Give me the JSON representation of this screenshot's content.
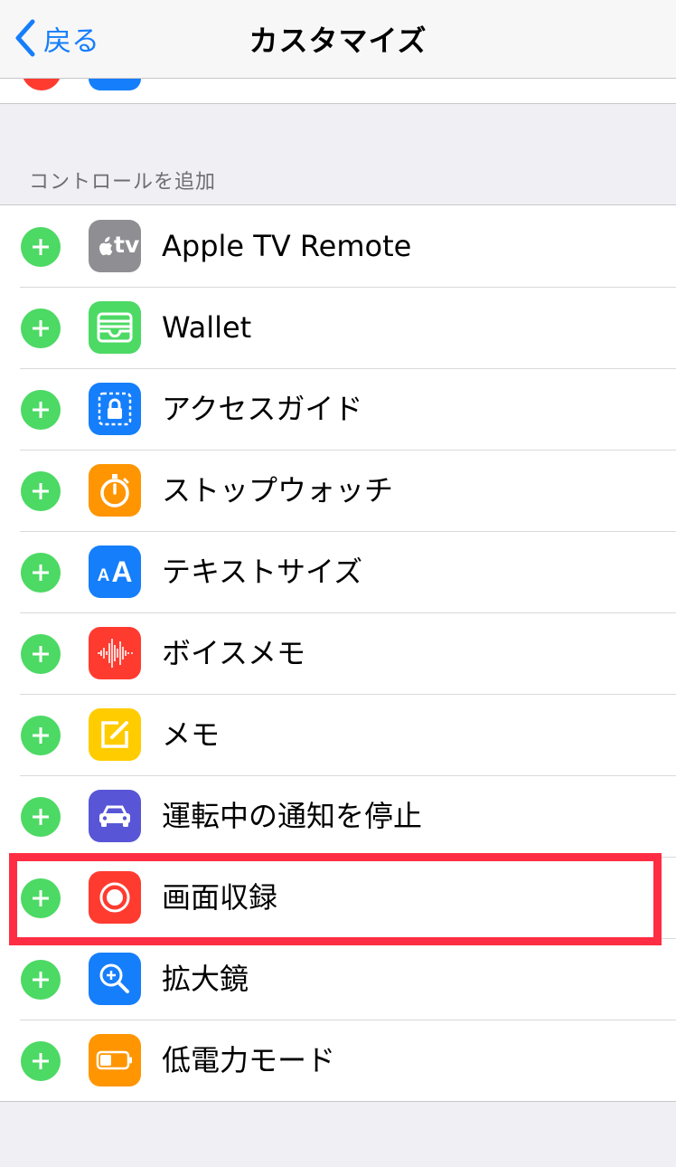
{
  "nav": {
    "back_label": "戻る",
    "title": "カスタマイズ"
  },
  "section": {
    "header": "コントロールを追加"
  },
  "items": [
    {
      "label": "Apple TV Remote",
      "icon": "apple-tv-icon",
      "color": "#8e8e93"
    },
    {
      "label": "Wallet",
      "icon": "wallet-icon",
      "color": "#4cd964"
    },
    {
      "label": "アクセスガイド",
      "icon": "guided-access-icon",
      "color": "#157efb"
    },
    {
      "label": "ストップウォッチ",
      "icon": "stopwatch-icon",
      "color": "#ff9500"
    },
    {
      "label": "テキストサイズ",
      "icon": "text-size-icon",
      "color": "#157efb"
    },
    {
      "label": "ボイスメモ",
      "icon": "voice-memo-icon",
      "color": "#ff3b30"
    },
    {
      "label": "メモ",
      "icon": "notes-icon",
      "color": "#ffcc00"
    },
    {
      "label": "運転中の通知を停止",
      "icon": "car-icon",
      "color": "#5856d6"
    },
    {
      "label": "画面収録",
      "icon": "screen-record-icon",
      "color": "#ff3b30",
      "highlighted": true
    },
    {
      "label": "拡大鏡",
      "icon": "magnifier-icon",
      "color": "#157efb"
    },
    {
      "label": "低電力モード",
      "icon": "battery-icon",
      "color": "#ff9500"
    }
  ],
  "apple_tv_text": "tv",
  "text_size_glyph": {
    "small": "A",
    "large": "A"
  },
  "highlight_color": "#ff2d43"
}
